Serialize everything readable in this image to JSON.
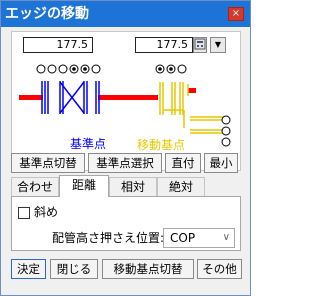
{
  "window": {
    "title": "エッジの移動",
    "close_glyph": "×"
  },
  "diagram": {
    "left_value": "177.5",
    "right_value": "177.5",
    "calc_icon": "calculator-icon",
    "dropdown_glyph": "▼",
    "label_base": "基準点",
    "label_move": "移動基点",
    "colors": {
      "pipe": "#ff0000",
      "base": "#0000ff",
      "move": "#e6c800"
    }
  },
  "toolbar": {
    "base_switch": "基準点切替",
    "base_select": "基準点選択",
    "direct": "直付",
    "minimum": "最小"
  },
  "tabs": [
    "合わせ",
    "距離",
    "相対",
    "絶対"
  ],
  "active_tab": "距離",
  "options": {
    "diagonal_label": "斜め",
    "diagonal_checked": false,
    "position_label": "配管高さ押さえ位置:",
    "position_value": "COP",
    "position_chevron": "∨"
  },
  "buttons": {
    "ok": "決定",
    "close": "閉じる",
    "move_switch": "移動基点切替",
    "other": "その他"
  }
}
